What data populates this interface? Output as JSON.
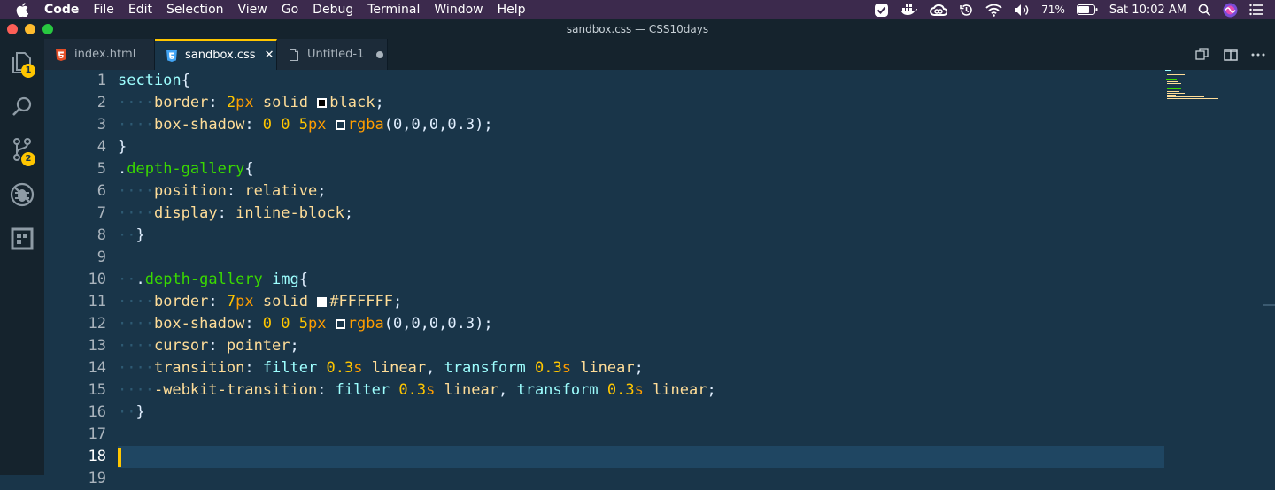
{
  "menubar": {
    "app": "Code",
    "items": [
      "File",
      "Edit",
      "Selection",
      "View",
      "Go",
      "Debug",
      "Terminal",
      "Window",
      "Help"
    ],
    "battery": "71%",
    "clock": "Sat 10:02 AM"
  },
  "window": {
    "title": "sandbox.css — CSS10days"
  },
  "activity": {
    "explorer_badge": "1",
    "scm_badge": "2"
  },
  "tabs": [
    {
      "label": "index.html",
      "icon": "html5-icon"
    },
    {
      "label": "sandbox.css",
      "icon": "css3-icon",
      "active": true
    },
    {
      "label": "Untitled-1",
      "icon": "file-icon",
      "dirty": true
    }
  ],
  "editor": {
    "current_line": 18,
    "line_numbers": [
      "1",
      "2",
      "3",
      "4",
      "5",
      "6",
      "7",
      "8",
      "9",
      "10",
      "11",
      "12",
      "13",
      "14",
      "15",
      "16",
      "17",
      "18",
      "19"
    ],
    "lines": [
      [
        {
          "t": "section",
          "c": "sel"
        },
        {
          "t": "{",
          "c": "val"
        }
      ],
      [
        {
          "t": "····",
          "c": "ws"
        },
        {
          "t": "border",
          "c": "prop"
        },
        {
          "t": ": ",
          "c": "val"
        },
        {
          "t": "2",
          "c": "kw"
        },
        {
          "t": "px",
          "c": "num"
        },
        {
          "t": " ",
          "c": "val"
        },
        {
          "t": "solid",
          "c": "prop"
        },
        {
          "t": " ",
          "c": "val"
        },
        {
          "sw": "#000000"
        },
        {
          "t": "black",
          "c": "prop"
        },
        {
          "t": ";",
          "c": "val"
        }
      ],
      [
        {
          "t": "····",
          "c": "ws"
        },
        {
          "t": "box-shadow",
          "c": "prop"
        },
        {
          "t": ": ",
          "c": "val"
        },
        {
          "t": "0",
          "c": "kw"
        },
        {
          "t": " ",
          "c": "val"
        },
        {
          "t": "0",
          "c": "kw"
        },
        {
          "t": " ",
          "c": "val"
        },
        {
          "t": "5",
          "c": "kw"
        },
        {
          "t": "px",
          "c": "num"
        },
        {
          "t": " ",
          "c": "val"
        },
        {
          "sw": "#193549"
        },
        {
          "t": "rgba",
          "c": "fn"
        },
        {
          "t": "(0,0,0,0.3);",
          "c": "val"
        }
      ],
      [
        {
          "t": "}",
          "c": "val"
        }
      ],
      [
        {
          "t": ".",
          "c": "val"
        },
        {
          "t": "depth-gallery",
          "c": "cls"
        },
        {
          "t": "{",
          "c": "val"
        }
      ],
      [
        {
          "t": "····",
          "c": "ws"
        },
        {
          "t": "position",
          "c": "prop"
        },
        {
          "t": ": ",
          "c": "val"
        },
        {
          "t": "relative",
          "c": "prop"
        },
        {
          "t": ";",
          "c": "val"
        }
      ],
      [
        {
          "t": "····",
          "c": "ws"
        },
        {
          "t": "display",
          "c": "prop"
        },
        {
          "t": ": ",
          "c": "val"
        },
        {
          "t": "inline-block",
          "c": "prop"
        },
        {
          "t": ";",
          "c": "val"
        }
      ],
      [
        {
          "t": "··",
          "c": "ws"
        },
        {
          "t": "}",
          "c": "val"
        }
      ],
      [],
      [
        {
          "t": "··",
          "c": "ws"
        },
        {
          "t": ".",
          "c": "val"
        },
        {
          "t": "depth-gallery",
          "c": "cls"
        },
        {
          "t": " ",
          "c": "val"
        },
        {
          "t": "img",
          "c": "sel"
        },
        {
          "t": "{",
          "c": "val"
        }
      ],
      [
        {
          "t": "····",
          "c": "ws"
        },
        {
          "t": "border",
          "c": "prop"
        },
        {
          "t": ": ",
          "c": "val"
        },
        {
          "t": "7",
          "c": "kw"
        },
        {
          "t": "px",
          "c": "num"
        },
        {
          "t": " ",
          "c": "val"
        },
        {
          "t": "solid",
          "c": "prop"
        },
        {
          "t": " ",
          "c": "val"
        },
        {
          "sw": "#FFFFFF"
        },
        {
          "t": "#FFFFFF",
          "c": "prop"
        },
        {
          "t": ";",
          "c": "val"
        }
      ],
      [
        {
          "t": "····",
          "c": "ws"
        },
        {
          "t": "box-shadow",
          "c": "prop"
        },
        {
          "t": ": ",
          "c": "val"
        },
        {
          "t": "0",
          "c": "kw"
        },
        {
          "t": " ",
          "c": "val"
        },
        {
          "t": "0",
          "c": "kw"
        },
        {
          "t": " ",
          "c": "val"
        },
        {
          "t": "5",
          "c": "kw"
        },
        {
          "t": "px",
          "c": "num"
        },
        {
          "t": " ",
          "c": "val"
        },
        {
          "sw": "#193549"
        },
        {
          "t": "rgba",
          "c": "fn"
        },
        {
          "t": "(0,0,0,0.3);",
          "c": "val"
        }
      ],
      [
        {
          "t": "····",
          "c": "ws"
        },
        {
          "t": "cursor",
          "c": "prop"
        },
        {
          "t": ": ",
          "c": "val"
        },
        {
          "t": "pointer",
          "c": "prop"
        },
        {
          "t": ";",
          "c": "val"
        }
      ],
      [
        {
          "t": "····",
          "c": "ws"
        },
        {
          "t": "transition",
          "c": "prop"
        },
        {
          "t": ": ",
          "c": "val"
        },
        {
          "t": "filter",
          "c": "sel"
        },
        {
          "t": " ",
          "c": "val"
        },
        {
          "t": "0.3",
          "c": "kw"
        },
        {
          "t": "s",
          "c": "num"
        },
        {
          "t": " ",
          "c": "val"
        },
        {
          "t": "linear",
          "c": "prop"
        },
        {
          "t": ", ",
          "c": "val"
        },
        {
          "t": "transform",
          "c": "sel"
        },
        {
          "t": " ",
          "c": "val"
        },
        {
          "t": "0.3",
          "c": "kw"
        },
        {
          "t": "s",
          "c": "num"
        },
        {
          "t": " ",
          "c": "val"
        },
        {
          "t": "linear",
          "c": "prop"
        },
        {
          "t": ";",
          "c": "val"
        }
      ],
      [
        {
          "t": "····",
          "c": "ws"
        },
        {
          "t": "-webkit-transition",
          "c": "prop"
        },
        {
          "t": ": ",
          "c": "val"
        },
        {
          "t": "filter",
          "c": "sel"
        },
        {
          "t": " ",
          "c": "val"
        },
        {
          "t": "0.3",
          "c": "kw"
        },
        {
          "t": "s",
          "c": "num"
        },
        {
          "t": " ",
          "c": "val"
        },
        {
          "t": "linear",
          "c": "prop"
        },
        {
          "t": ", ",
          "c": "val"
        },
        {
          "t": "transform",
          "c": "sel"
        },
        {
          "t": " ",
          "c": "val"
        },
        {
          "t": "0.3",
          "c": "kw"
        },
        {
          "t": "s",
          "c": "num"
        },
        {
          "t": " ",
          "c": "val"
        },
        {
          "t": "linear",
          "c": "prop"
        },
        {
          "t": ";",
          "c": "val"
        }
      ],
      [
        {
          "t": "··",
          "c": "ws"
        },
        {
          "t": "}",
          "c": "val"
        }
      ],
      [],
      []
    ]
  },
  "colors": {
    "background": "#193549",
    "accent": "#ffc600",
    "menubar": "#3c2a4d"
  }
}
